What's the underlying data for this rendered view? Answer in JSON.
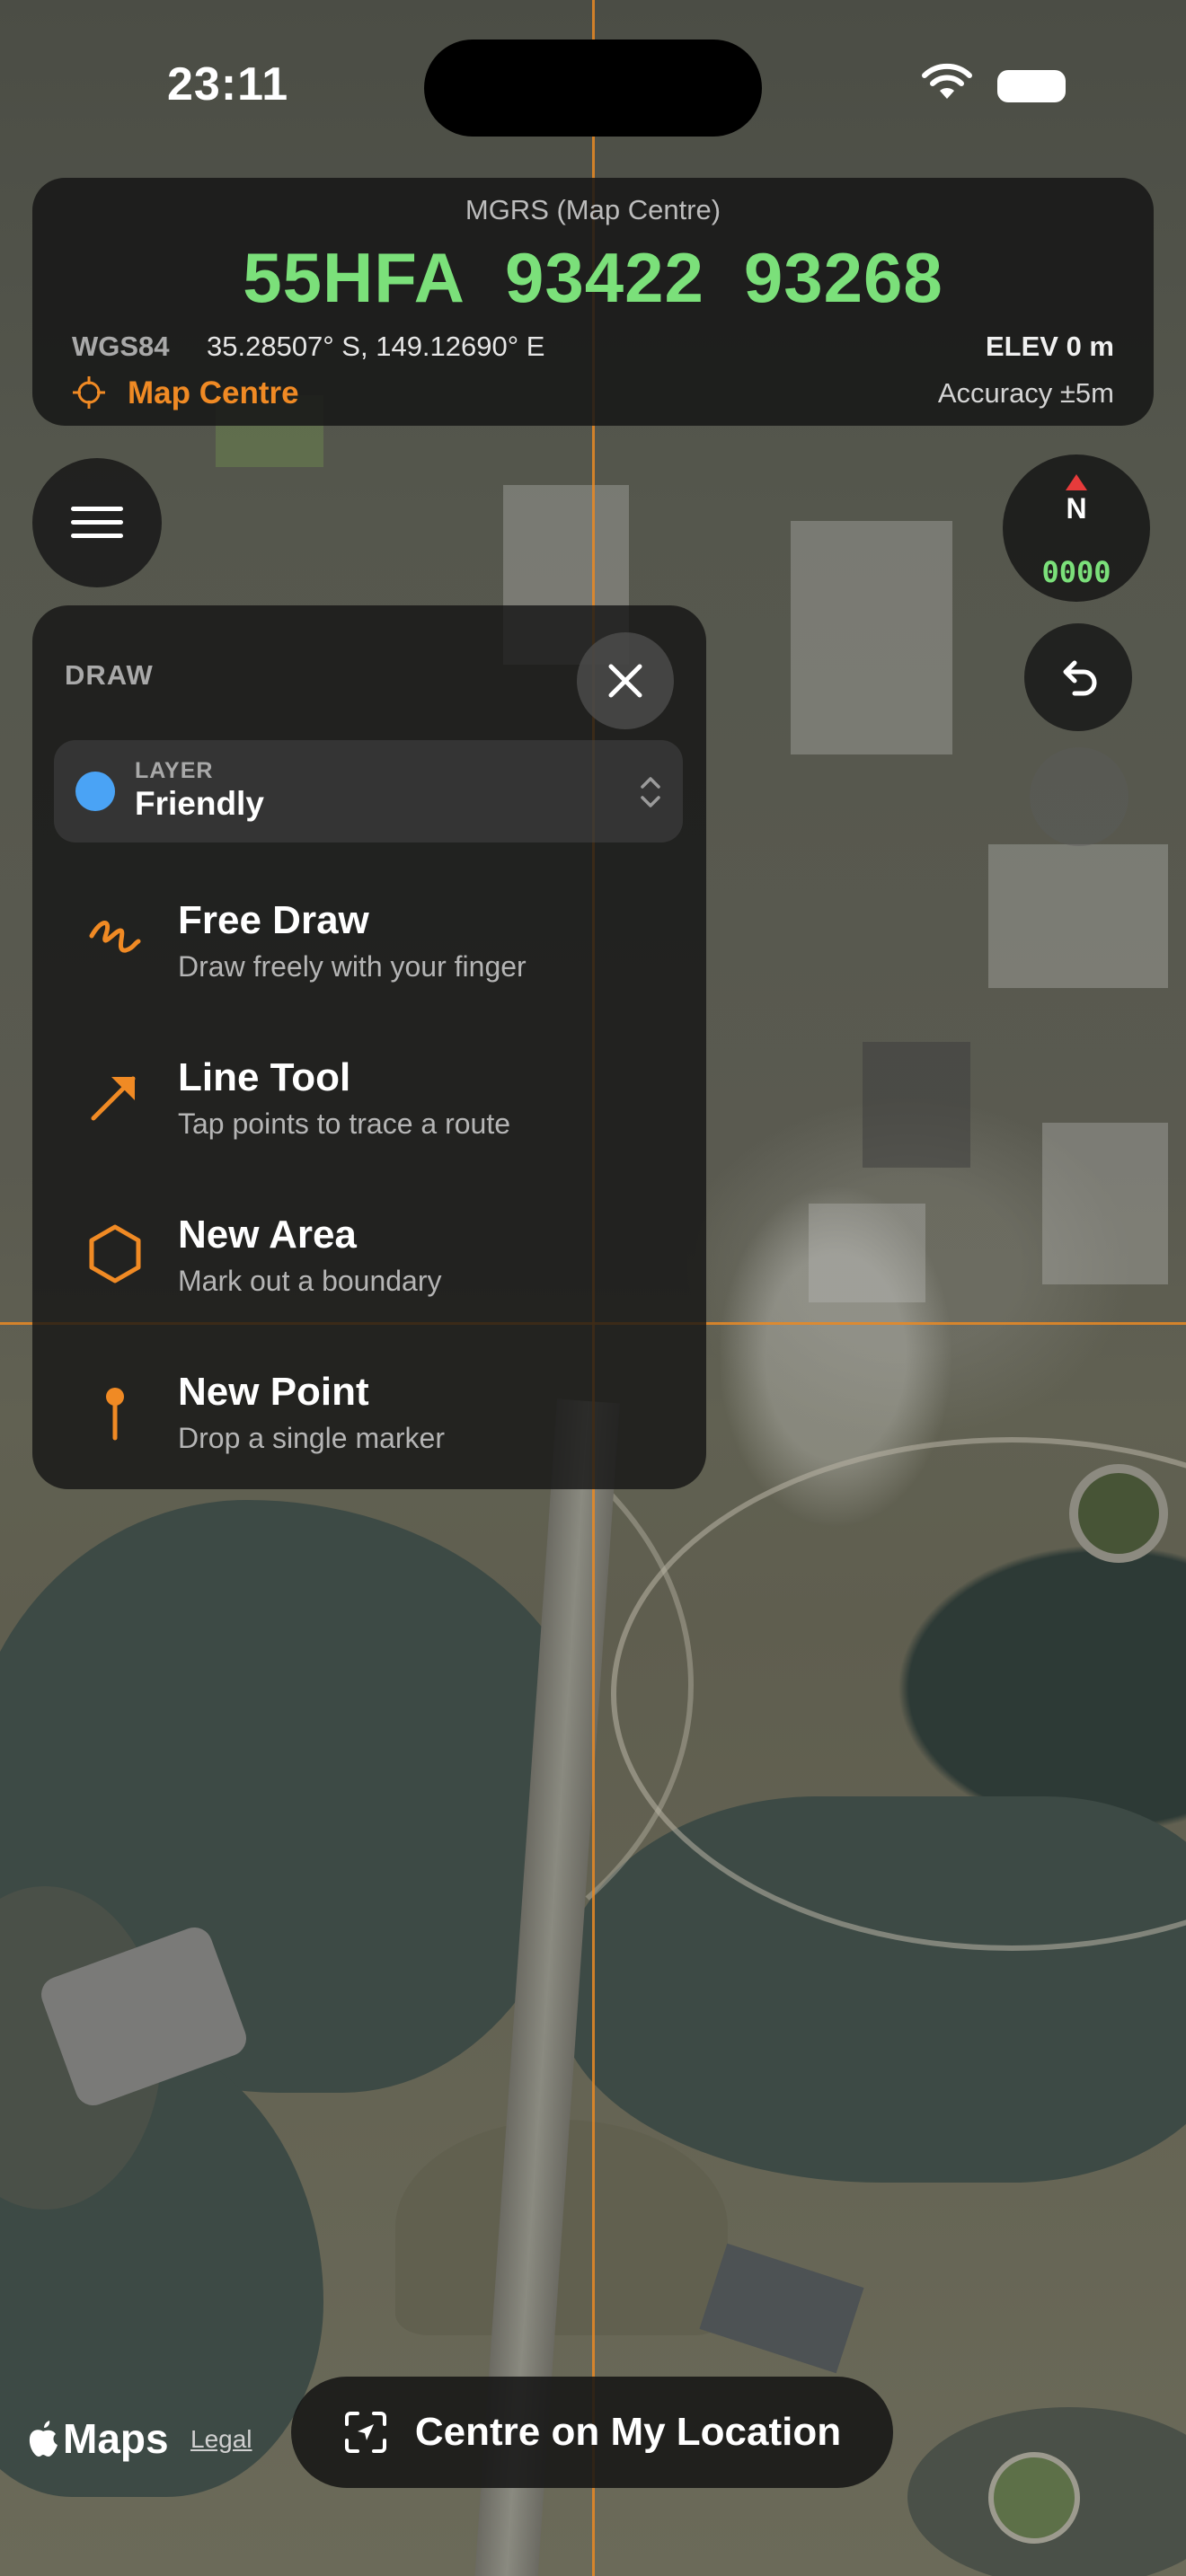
{
  "status_bar": {
    "time": "23:11"
  },
  "coordinates": {
    "caption": "MGRS (Map Centre)",
    "mgrs_zone": "55HFA",
    "mgrs_easting": "93422",
    "mgrs_northing": "93268",
    "datum_label": "WGS84",
    "latlon": "35.28507° S, 149.12690° E",
    "elevation": "ELEV 0 m",
    "source_label": "Map Centre",
    "accuracy": "Accuracy ±5m",
    "accent_color": "#7be07a",
    "source_color": "#f08a24"
  },
  "compass": {
    "north_label": "N",
    "heading": "0000"
  },
  "draw_panel": {
    "title": "DRAW",
    "layer": {
      "label": "LAYER",
      "value": "Friendly",
      "color": "#4aa3f5"
    },
    "tools": [
      {
        "name": "Free Draw",
        "description": "Draw freely with your finger",
        "icon": "squiggle-icon"
      },
      {
        "name": "Line Tool",
        "description": "Tap points to trace a route",
        "icon": "arrow-icon"
      },
      {
        "name": "New Area",
        "description": "Mark out a boundary",
        "icon": "hexagon-icon"
      },
      {
        "name": "New Point",
        "description": "Drop a single marker",
        "icon": "pin-icon"
      }
    ]
  },
  "map_attribution": {
    "brand": "Maps",
    "legal": "Legal"
  },
  "centre_button": {
    "label": "Centre on My Location"
  }
}
